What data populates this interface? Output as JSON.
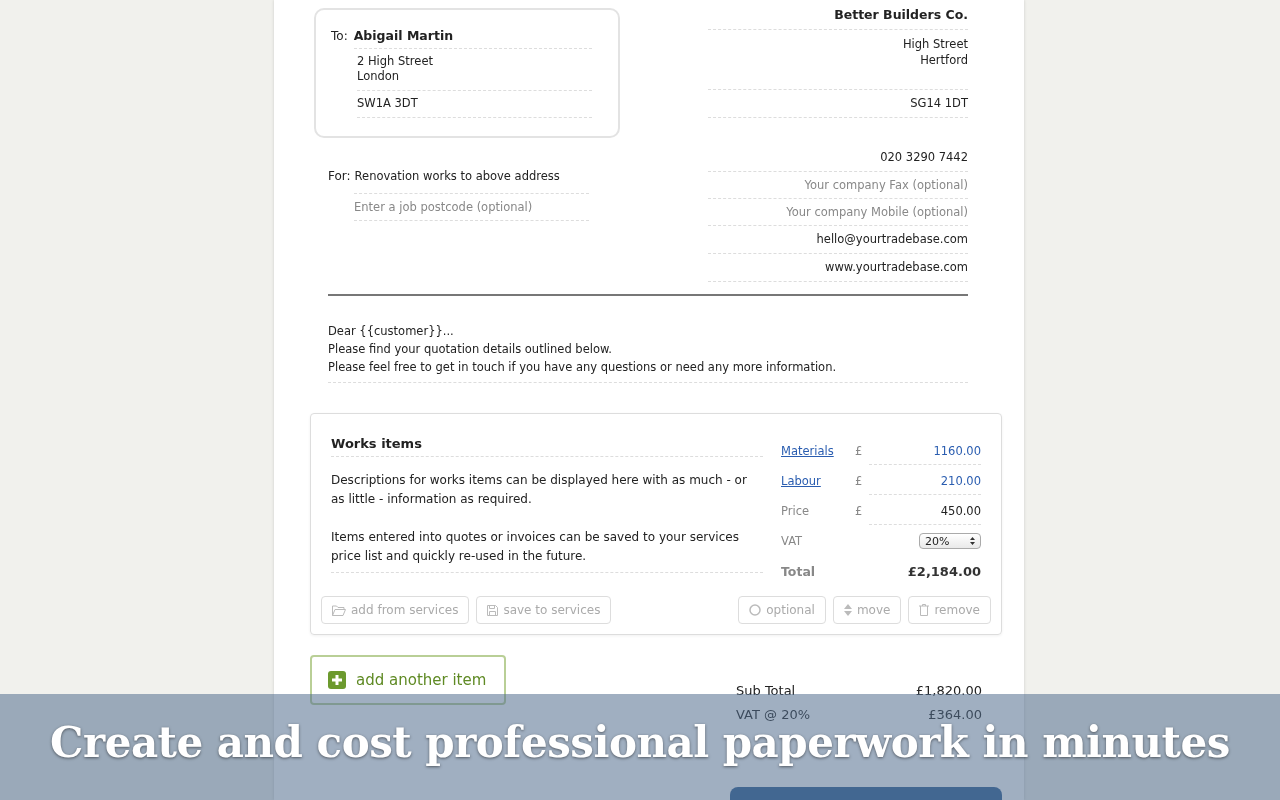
{
  "recipient": {
    "label": "To:",
    "name": "Abigail Martin",
    "address_lines": [
      "2 High Street",
      "London"
    ],
    "postcode": "SW1A 3DT"
  },
  "job": {
    "label": "For:",
    "description": "Renovation works to above address",
    "postcode_placeholder": "Enter a job postcode (optional)"
  },
  "company": {
    "name": "Better Builders Co.",
    "address_lines": [
      "High Street",
      "Hertford"
    ],
    "postcode": "SG14 1DT",
    "phone": "020 3290 7442",
    "fax_placeholder": "Your company Fax (optional)",
    "mobile_placeholder": "Your company Mobile (optional)",
    "email": "hello@yourtradebase.com",
    "website": "www.yourtradebase.com"
  },
  "letter": [
    "Dear {{customer}}...",
    "Please find your quotation details outlined below.",
    "Please feel free to get in touch if you have any questions or need any more information."
  ],
  "works_item": {
    "title": "Works items",
    "paragraphs": [
      "Descriptions for works items can be displayed here with as much - or as little - information as required.",
      "Items entered into quotes or invoices can be saved to your services price list and quickly re-used in the future."
    ],
    "costs": [
      {
        "kind": "link",
        "label": "Materials",
        "currency": "£",
        "value": "1160.00"
      },
      {
        "kind": "link",
        "label": "Labour",
        "currency": "£",
        "value": "210.00"
      },
      {
        "kind": "plain",
        "label": "Price",
        "currency": "£",
        "value": "450.00"
      }
    ],
    "vat": {
      "label": "VAT",
      "value": "20%"
    },
    "total": {
      "label": "Total",
      "value": "£2,184.00"
    },
    "actions_left": [
      {
        "kind": "folder",
        "label": "add from services"
      },
      {
        "kind": "save",
        "label": "save to services"
      }
    ],
    "actions_right": [
      {
        "kind": "circle",
        "label": "optional"
      },
      {
        "kind": "updown",
        "label": "move"
      },
      {
        "kind": "trash",
        "label": "remove"
      }
    ]
  },
  "add_item": {
    "label": "add another item"
  },
  "totals": [
    {
      "label": "Sub Total",
      "value": "£1,820.00"
    },
    {
      "label": "VAT @ 20%",
      "value": "£364.00"
    }
  ],
  "caption": "Create and cost professional paperwork in minutes"
}
